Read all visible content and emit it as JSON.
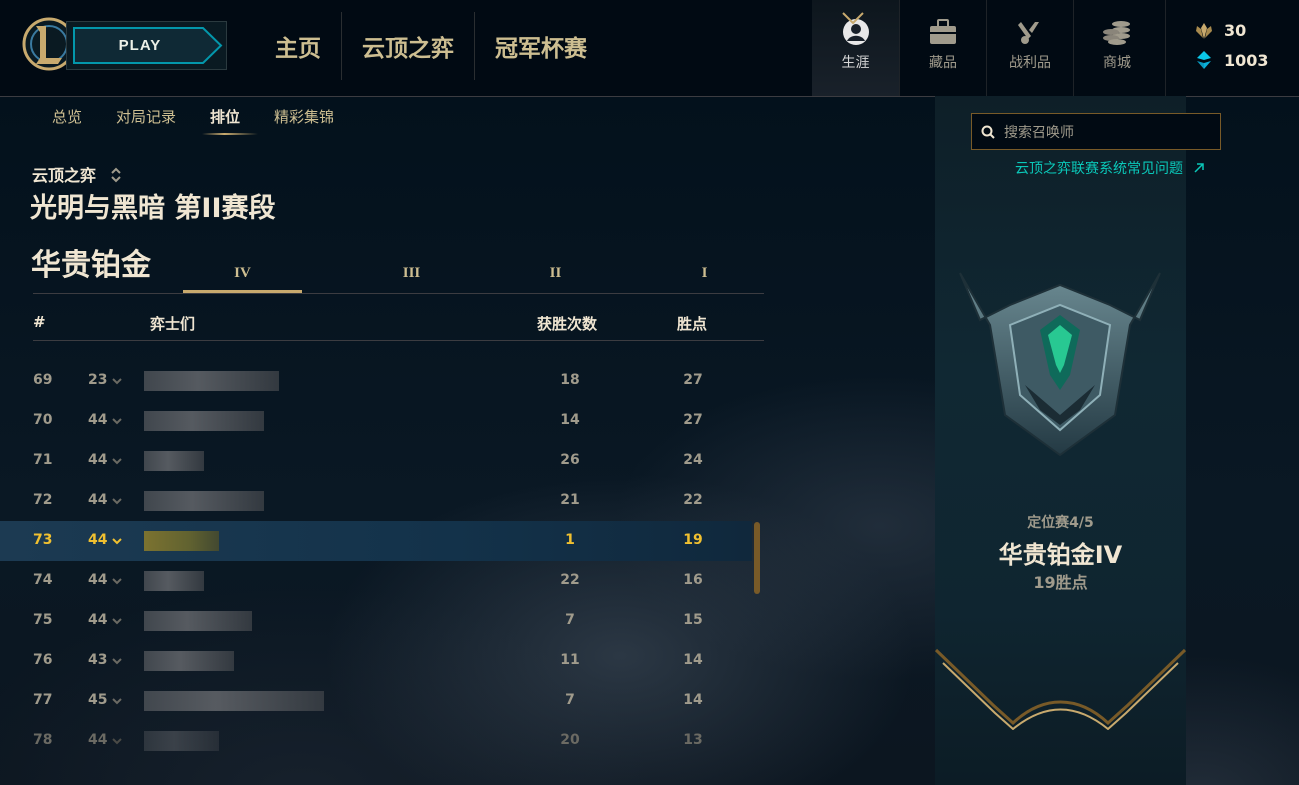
{
  "topbar": {
    "play_label": "PLAY",
    "nav": [
      "主页",
      "云顶之弈",
      "冠军杯赛"
    ],
    "icons": [
      {
        "label": "生涯",
        "icon": "profile-icon"
      },
      {
        "label": "藏品",
        "icon": "collection-icon"
      },
      {
        "label": "战利品",
        "icon": "loot-icon"
      },
      {
        "label": "商城",
        "icon": "store-icon"
      }
    ],
    "currency": {
      "orange_essence": "30",
      "blue_essence": "1003"
    }
  },
  "subnav": [
    "总览",
    "对局记录",
    "排位",
    "精彩集锦"
  ],
  "queue": "云顶之弈",
  "season": "光明与黑暗 第II赛段",
  "tier": "华贵铂金",
  "divisions": [
    "IV",
    "III",
    "II",
    "I"
  ],
  "columns": {
    "rank": "#",
    "players": "弈士们",
    "wins": "获胜次数",
    "lp": "胜点"
  },
  "rows": [
    {
      "rank": "69",
      "level": "23",
      "wins": "18",
      "lp": "27"
    },
    {
      "rank": "70",
      "level": "44",
      "wins": "14",
      "lp": "27"
    },
    {
      "rank": "71",
      "level": "44",
      "wins": "26",
      "lp": "24"
    },
    {
      "rank": "72",
      "level": "44",
      "wins": "21",
      "lp": "22"
    },
    {
      "rank": "73",
      "level": "44",
      "wins": "1",
      "lp": "19"
    },
    {
      "rank": "74",
      "level": "44",
      "wins": "22",
      "lp": "16"
    },
    {
      "rank": "75",
      "level": "44",
      "wins": "7",
      "lp": "15"
    },
    {
      "rank": "76",
      "level": "43",
      "wins": "11",
      "lp": "14"
    },
    {
      "rank": "77",
      "level": "45",
      "wins": "7",
      "lp": "14"
    },
    {
      "rank": "78",
      "level": "44",
      "wins": "20",
      "lp": "13"
    }
  ],
  "search": {
    "placeholder": "搜索召唤师"
  },
  "faq_link": "云顶之弈联赛系统常见问题",
  "profile": {
    "placement": "定位赛4/5",
    "rank": "华贵铂金IV",
    "lp": "19胜点"
  },
  "colors": {
    "gold": "#c8aa6e",
    "highlight": "#f0c030",
    "teal": "#0ac8b9"
  }
}
